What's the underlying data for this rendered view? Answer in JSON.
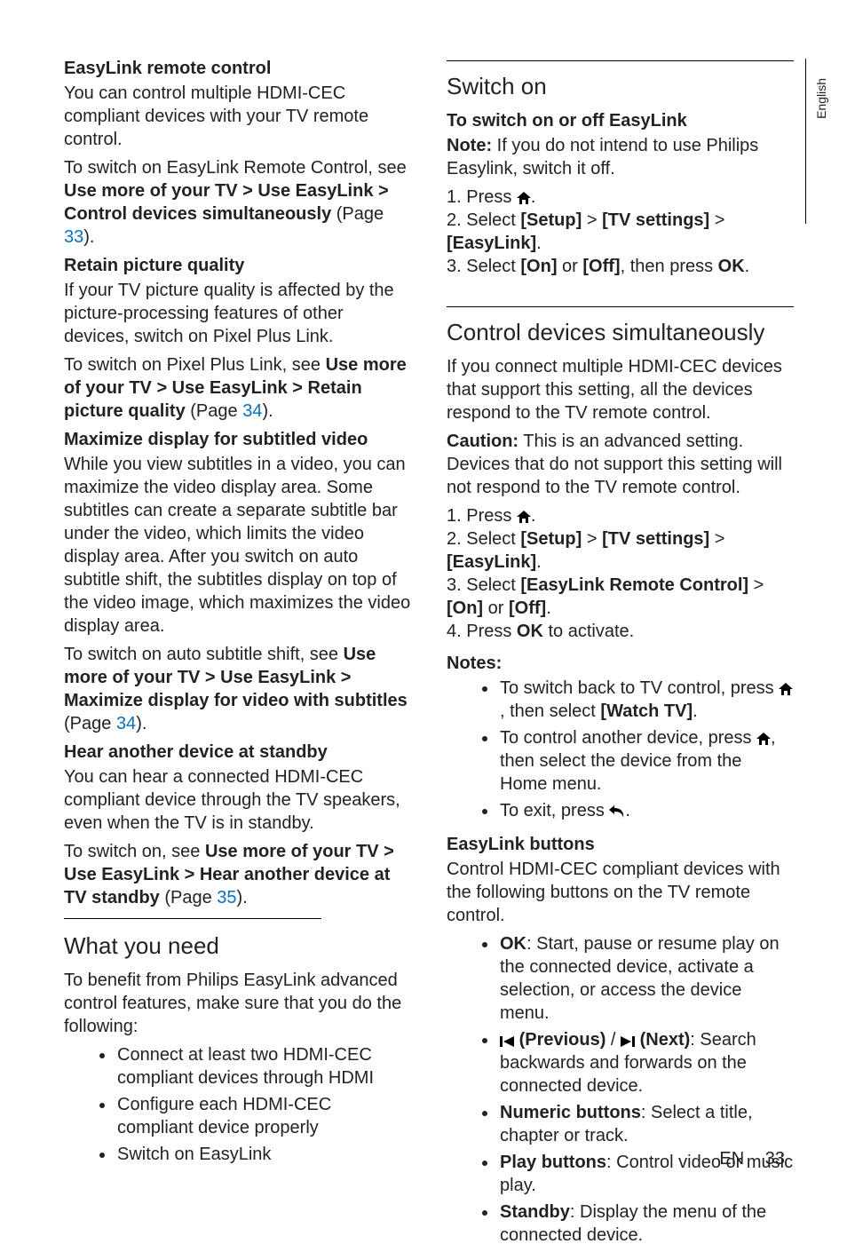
{
  "lang": "English",
  "footer": {
    "lang_code": "EN",
    "page_num": "33"
  },
  "left": {
    "t1": "EasyLink remote control",
    "p1": "You can control multiple HDMI-CEC compliant devices with your TV remote control.",
    "p2a": "To switch on EasyLink Remote Control, see ",
    "p2b": "Use more of your TV > Use EasyLink > Control devices simultaneously",
    "p2c": " (Page ",
    "p2d": "33",
    "p2e": ").",
    "t2": "Retain picture quality",
    "p3": "If your TV picture quality is affected by the picture-processing features of other devices, switch on Pixel Plus Link.",
    "p4a": "To switch on Pixel Plus Link, see ",
    "p4b": "Use more of your TV > Use EasyLink > Retain picture quality",
    "p4c": " (Page ",
    "p4d": "34",
    "p4e": ").",
    "t3": "Maximize display for subtitled video",
    "p5": "While you view subtitles in a video, you can maximize the video display area. Some subtitles can create a separate subtitle bar under the video, which limits the video display area. After you switch on auto subtitle shift, the subtitles display on top of the video image, which maximizes the video display area.",
    "p6a": "To switch on auto subtitle shift, see ",
    "p6b": "Use more of your TV > Use EasyLink > Maximize display for video with subtitles",
    "p6c": " (Page ",
    "p6d": "34",
    "p6e": ").",
    "t4": "Hear another device at standby",
    "p7": "You can hear a connected HDMI-CEC compliant device through the TV speakers, even when the TV is in standby.",
    "p8a": "To switch on, see ",
    "p8b": "Use more of your TV > Use EasyLink > Hear another device at TV standby",
    "p8c": " (Page ",
    "p8d": "35",
    "p8e": ").",
    "h_wyn": "What you need",
    "p9": "To benefit from Philips EasyLink advanced control features, make sure that you do the following:",
    "wyn1": "Connect at least two HDMI-CEC compliant devices through HDMI",
    "wyn2": "Configure each HDMI-CEC compliant device properly",
    "wyn3": "Switch on EasyLink"
  },
  "right": {
    "h_so": "Switch on",
    "t1": "To switch on or off EasyLink",
    "p1a": "Note:",
    "p1b": " If you do not intend to use Philips Easylink, switch it off.",
    "s1_1a": "1. Press ",
    "dot": ".",
    "s1_2a": "2. Select ",
    "setup": "[Setup]",
    "gt": " > ",
    "tvset": "[TV settings]",
    "easylink": "[EasyLink]",
    "s1_3a": "3. Select ",
    "on": "[On]",
    "or": " or ",
    "off": "[Off]",
    "then_press": ", then press ",
    "ok": "OK",
    "h_cds": "Control devices simultaneously",
    "p2": "If you connect multiple HDMI-CEC devices that support this setting, all the devices respond to the TV remote control.",
    "p3a": "Caution:",
    "p3b": " This is an advanced setting. Devices that do not support this setting will not respond to the TV remote control.",
    "s2_3a": "3. Select ",
    "elrc": "[EasyLink Remote Control]",
    "s2_4a": "4. Press ",
    "activate": " to activate.",
    "notes": "Notes:",
    "n1a": "To switch back to TV control, press ",
    "n1b": ", then select ",
    "watch": "[Watch TV]",
    "n2a": "To control another device, press ",
    "n2b": ", then select the device from the Home menu.",
    "n3a": "To exit, press ",
    "t_elb": "EasyLink buttons",
    "p4": "Control HDMI-CEC compliant devices with the following buttons on the TV remote control.",
    "b1a": "OK",
    "b1b": ": Start, pause or resume play on the connected device, activate a selection, or access the device menu.",
    "b2a": "(Previous)",
    "b2b": " / ",
    "b2c": "(Next)",
    "b2d": ": Search backwards and forwards on the connected device.",
    "b3a": "Numeric buttons",
    "b3b": ": Select a title, chapter or track.",
    "b4a": "Play buttons",
    "b4b": ": Control video or music play.",
    "b5a": "Standby",
    "b5b": ": Display the menu of the connected device."
  }
}
